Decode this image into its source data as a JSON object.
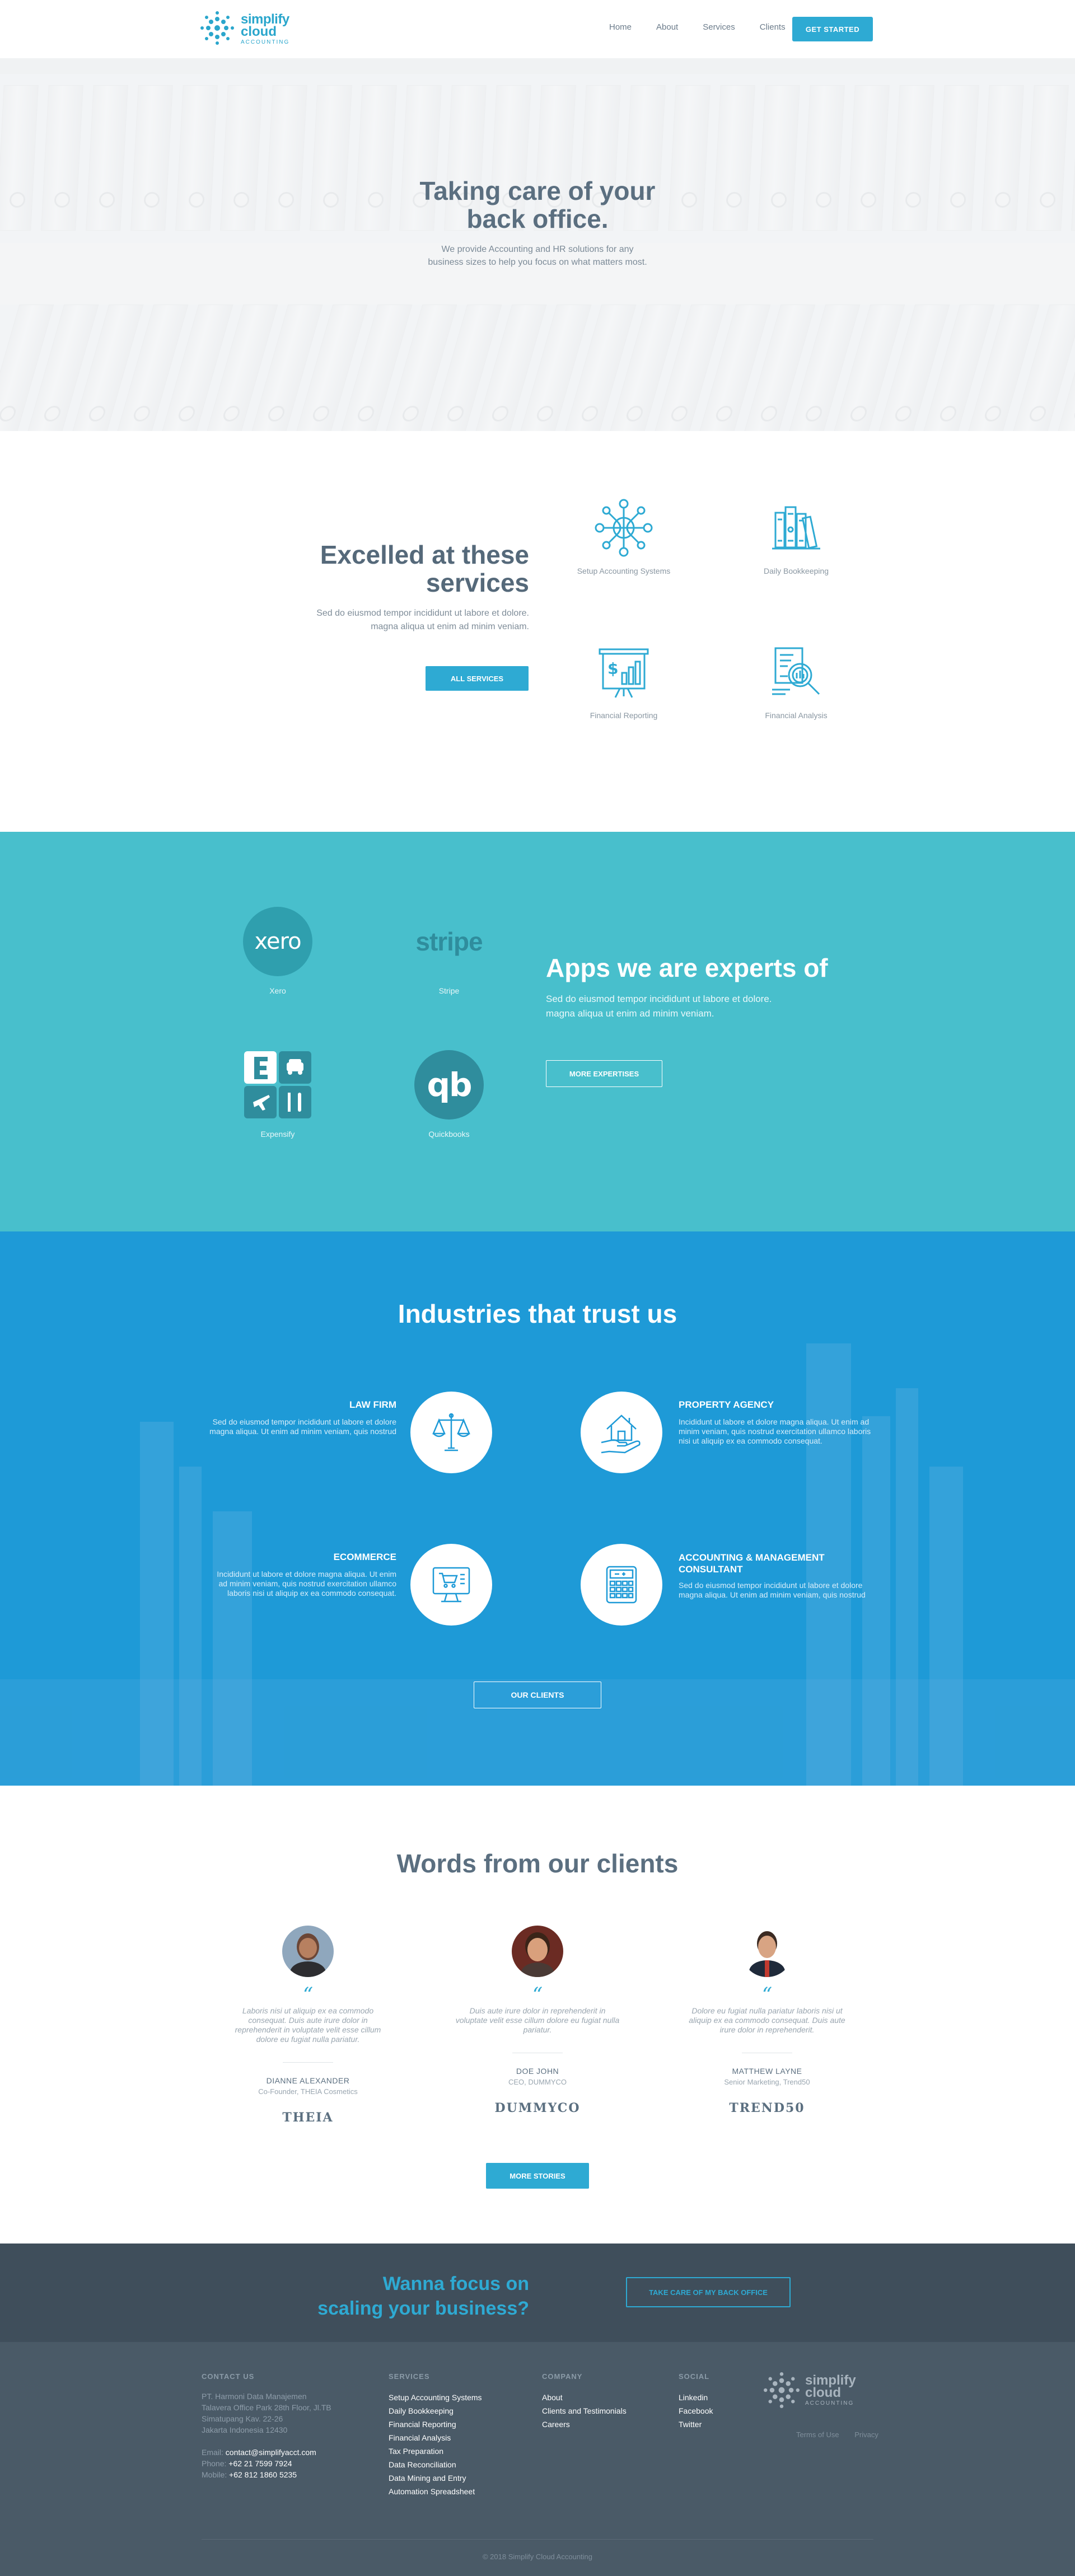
{
  "header": {
    "logo": {
      "name": "simplify",
      "name2": "cloud",
      "tagline": "ACCOUNTING"
    },
    "nav": [
      "Home",
      "About",
      "Services",
      "Clients"
    ],
    "cta_label": "GET STARTED"
  },
  "hero": {
    "title_line1": "Taking care of your",
    "title_line2": "back office.",
    "subtitle_line1": "We provide Accounting and HR solutions for any",
    "subtitle_line2": "business sizes  to help you focus on what matters most."
  },
  "services": {
    "title_line1": "Excelled at these",
    "title_line2": "services",
    "description_line1": "Sed do eiusmod tempor incididunt ut labore et dolore.",
    "description_line2": "magna aliqua ut enim ad minim veniam.",
    "button_label": "ALL SERVICES",
    "items": [
      {
        "label": "Setup Accounting Systems",
        "icon": "network-globe-icon"
      },
      {
        "label": "Daily Bookkeeping",
        "icon": "books-icon"
      },
      {
        "label": "Financial Reporting",
        "icon": "report-chart-icon"
      },
      {
        "label": "Financial Analysis",
        "icon": "magnifier-document-icon"
      }
    ]
  },
  "apps": {
    "title": "Apps we are experts of",
    "description_line1": "Sed do eiusmod tempor incididunt ut labore et dolore.",
    "description_line2": "magna aliqua ut enim ad minim veniam.",
    "button_label": "MORE EXPERTISES",
    "items": [
      {
        "label": "Xero",
        "logo_text": "xero"
      },
      {
        "label": "Stripe",
        "logo_text": "stripe"
      },
      {
        "label": "Expensify",
        "logo_text": "E"
      },
      {
        "label": "Quickbooks",
        "logo_text": "qb"
      }
    ]
  },
  "industries": {
    "title": "Industries that trust us",
    "button_label": "OUR CLIENTS",
    "items": [
      {
        "name": "LAW FIRM",
        "description": "Sed do eiusmod tempor incididunt ut labore et dolore magna aliqua. Ut enim ad minim veniam, quis nostrud",
        "icon": "scales-icon"
      },
      {
        "name": "PROPERTY AGENCY",
        "description": "Incididunt ut labore et dolore magna aliqua. Ut enim ad minim veniam, quis nostrud exercitation ullamco laboris nisi ut aliquip ex ea commodo consequat.",
        "icon": "house-hand-icon"
      },
      {
        "name": "ECOMMERCE",
        "description": "Incididunt ut labore et dolore magna aliqua. Ut enim ad minim veniam, quis nostrud exercitation ullamco laboris nisi ut aliquip ex ea commodo consequat.",
        "icon": "monitor-cart-icon"
      },
      {
        "name": "ACCOUNTING & MANAGEMENT CONSULTANT",
        "description": "Sed do eiusmod tempor incididunt ut labore et dolore magna aliqua. Ut enim ad minim veniam, quis nostrud",
        "icon": "calculator-icon"
      }
    ]
  },
  "testimonials": {
    "title": "Words from our clients",
    "button_label": "MORE STORIES",
    "items": [
      {
        "quote": "Laboris nisi ut aliquip ex ea commodo consequat. Duis aute irure dolor in reprehenderit in voluptate velit esse cillum dolore eu fugiat nulla pariatur.",
        "name": "DIANNE ALEXANDER",
        "role": "Co-Founder, THEIA Cosmetics",
        "logo": "THEIA"
      },
      {
        "quote": "Duis aute irure dolor in reprehenderit in voluptate velit esse cillum dolore eu fugiat nulla pariatur.",
        "name": "DOE JOHN",
        "role": "CEO, DUMMYCO",
        "logo": "DUMMYCO"
      },
      {
        "quote": "Dolore eu fugiat nulla pariatur laboris nisi ut aliquip ex ea commodo consequat. Duis aute irure dolor in reprehenderit.",
        "name": "MATTHEW LAYNE",
        "role": "Senior Marketing, Trend50",
        "logo": "TREND50"
      }
    ]
  },
  "cta": {
    "title_line1": "Wanna focus on",
    "title_line2": "scaling your business?",
    "button_label": "TAKE CARE OF MY BACK OFFICE"
  },
  "footer": {
    "contact": {
      "heading": "CONTACT US",
      "company": "PT. Harmoni Data Manajemen",
      "address1": "Talavera Office Park 28th Floor, Jl.TB",
      "address2": "Simatupang Kav. 22-26",
      "address3": "Jakarta Indonesia  12430",
      "email_label": "Email:",
      "email": "contact@simplifyacct.com",
      "phone_label": "Phone:",
      "phone": "+62 21 7599 7924",
      "mobile_label": "Mobile:",
      "mobile": "+62 812 1860 5235"
    },
    "services": {
      "heading": "SERVICES",
      "links": [
        "Setup Accounting Systems",
        "Daily Bookkeeping",
        "Financial Reporting",
        "Financial Analysis",
        "Tax Preparation",
        "Data Reconciliation",
        "Data Mining and Entry",
        "Automation Spreadsheet"
      ]
    },
    "company": {
      "heading": "COMPANY",
      "links": [
        "About",
        "Clients and Testimonials",
        "Careers"
      ]
    },
    "social": {
      "heading": "SOCIAL",
      "links": [
        "Linkedin",
        "Facebook",
        "Twitter"
      ]
    },
    "legal": [
      "Terms of Use",
      "Privacy"
    ],
    "copyright": "© 2018 Simplify Cloud Accounting"
  },
  "colors": {
    "primary": "#2eaad3",
    "apps_bg": "#48bfcc",
    "industries_bg": "#1e9ad7",
    "cta_bg": "#3f4e5b",
    "footer_bg": "#4a5a67",
    "heading": "#55697a"
  }
}
